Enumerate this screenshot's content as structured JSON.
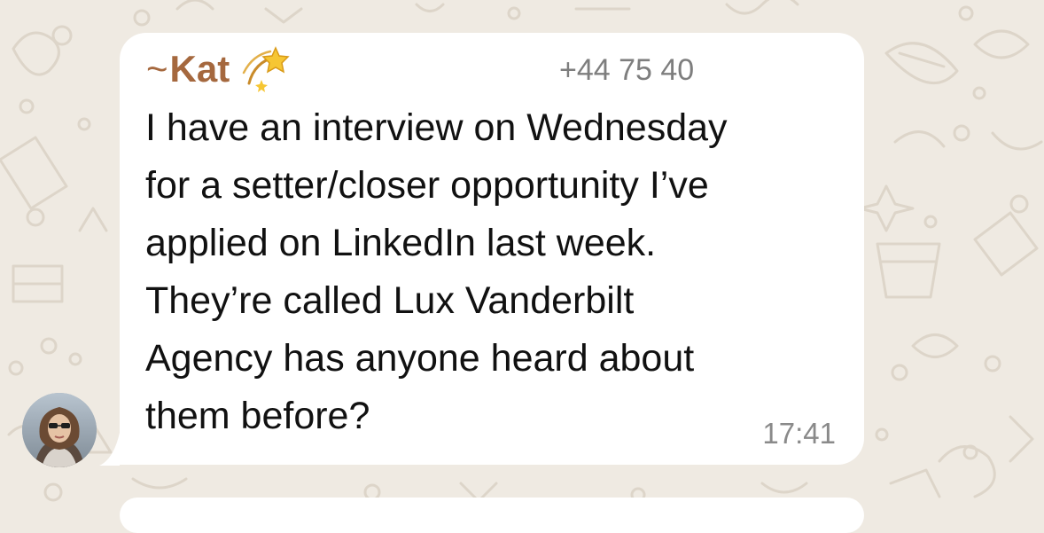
{
  "chat": {
    "sender_prefix": "~",
    "sender_name": "Kat",
    "sender_emoji": "dizzy-star-icon",
    "phone": "+44 75      40",
    "message_lines": [
      "I have an interview on Wednesday",
      "for a setter/closer opportunity I’ve",
      "applied on LinkedIn last week.",
      "They’re called Lux Vanderbilt",
      "Agency has anyone heard about",
      "them before?"
    ],
    "timestamp": "17:41"
  },
  "colors": {
    "background": "#efeae2",
    "bubble": "#ffffff",
    "sender_name": "#a5683e",
    "message_text": "#111111",
    "meta_text": "#8a8a8a"
  }
}
